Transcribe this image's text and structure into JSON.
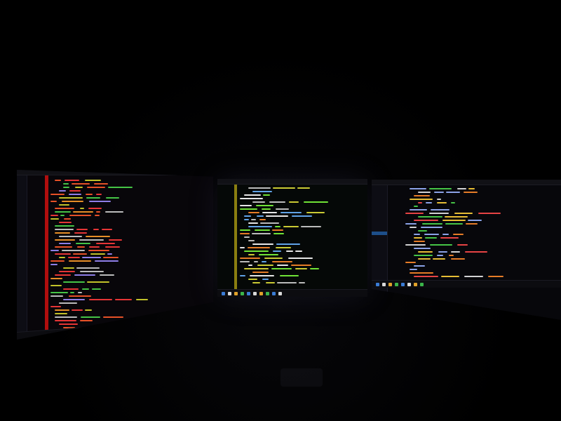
{
  "scene": {
    "description_visible": "",
    "background_color": "#000000"
  },
  "monitors": [
    {
      "id": "left",
      "palette": [
        "#ff3b3b",
        "#ff5a2a",
        "#d6d62c",
        "#4cd94c",
        "#cfcfcf",
        "#9d8cff",
        "#ff9c2a"
      ],
      "gutter_color": "#cc1111",
      "bg": "#08060a"
    },
    {
      "id": "center",
      "palette": [
        "#7cfc3c",
        "#e0e03a",
        "#ff8a2a",
        "#cfcfcf",
        "#6ab4ff",
        "#ffffff"
      ],
      "gutter_color": "#b8a814",
      "bg": "#050807"
    },
    {
      "id": "right",
      "palette": [
        "#e8e8e8",
        "#ffd23a",
        "#ff8a2a",
        "#ff4a4a",
        "#4cd94c",
        "#9ab4ff"
      ],
      "gutter_color": "#2a2a34",
      "bg": "#07070b"
    }
  ]
}
